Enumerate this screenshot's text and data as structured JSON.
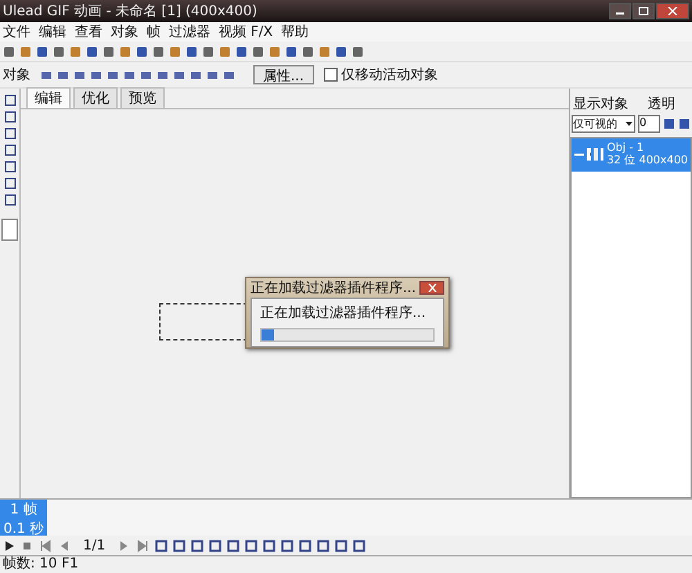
{
  "window": {
    "title": "Ulead GIF 动画 - 未命名 [1] (400x400)"
  },
  "menu": [
    "文件",
    "编辑",
    "查看",
    "对象",
    "帧",
    "过滤器",
    "视频 F/X",
    "帮助"
  ],
  "property_bar": {
    "label": "对象",
    "button": "属性...",
    "checkbox": {
      "label": "仅移动活动对象",
      "checked": false
    }
  },
  "tabs": [
    {
      "label": "编辑",
      "selected": true
    },
    {
      "label": "优化",
      "selected": false
    },
    {
      "label": "预览",
      "selected": false
    }
  ],
  "dialog": {
    "title": "正在加载过滤器插件程序...",
    "message": "正在加载过滤器插件程序...",
    "progress": {
      "level": 0.07
    }
  },
  "object_panel": {
    "show_label": "显示对象",
    "transparency_label": "透明",
    "show_value": "仅可视的",
    "transparency_value": "0",
    "objects": [
      {
        "name": "Obj - 1",
        "info": "32 位 400x400",
        "selected": true
      }
    ]
  },
  "frames": [
    {
      "label": "1 帧",
      "delay": "0.1 秒",
      "selected": true
    }
  ],
  "frame_counter": "1/1",
  "status_bar": "帧数: 10 F1"
}
